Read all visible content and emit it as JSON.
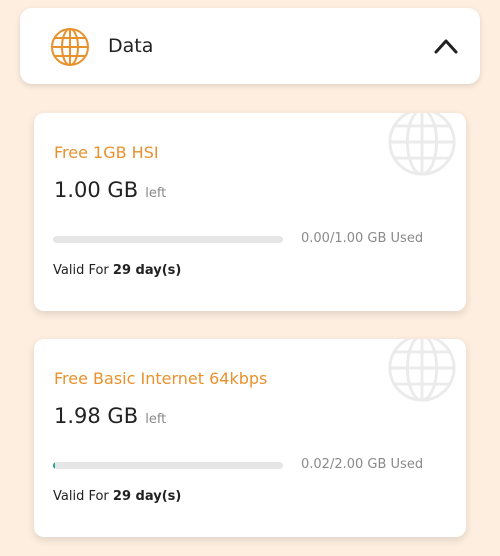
{
  "colors": {
    "background": "#fdeedf",
    "accent": "#e8912d",
    "progress": "#1aa68a",
    "track": "#e6e6e6"
  },
  "header": {
    "icon": "globe-icon",
    "title": "Data",
    "toggle_icon": "chevron-up-icon"
  },
  "plans": [
    {
      "name": "Free 1GB HSI",
      "amount": "1.00 GB",
      "left_label": "left",
      "used_text": "0.00/1.00 GB Used",
      "used_fraction": 0.0,
      "valid_label": "Valid For",
      "valid_value": "29 day(s)"
    },
    {
      "name": "Free Basic Internet 64kbps",
      "amount": "1.98 GB",
      "left_label": "left",
      "used_text": "0.02/2.00 GB Used",
      "used_fraction": 0.01,
      "valid_label": "Valid For",
      "valid_value": "29 day(s)"
    }
  ]
}
